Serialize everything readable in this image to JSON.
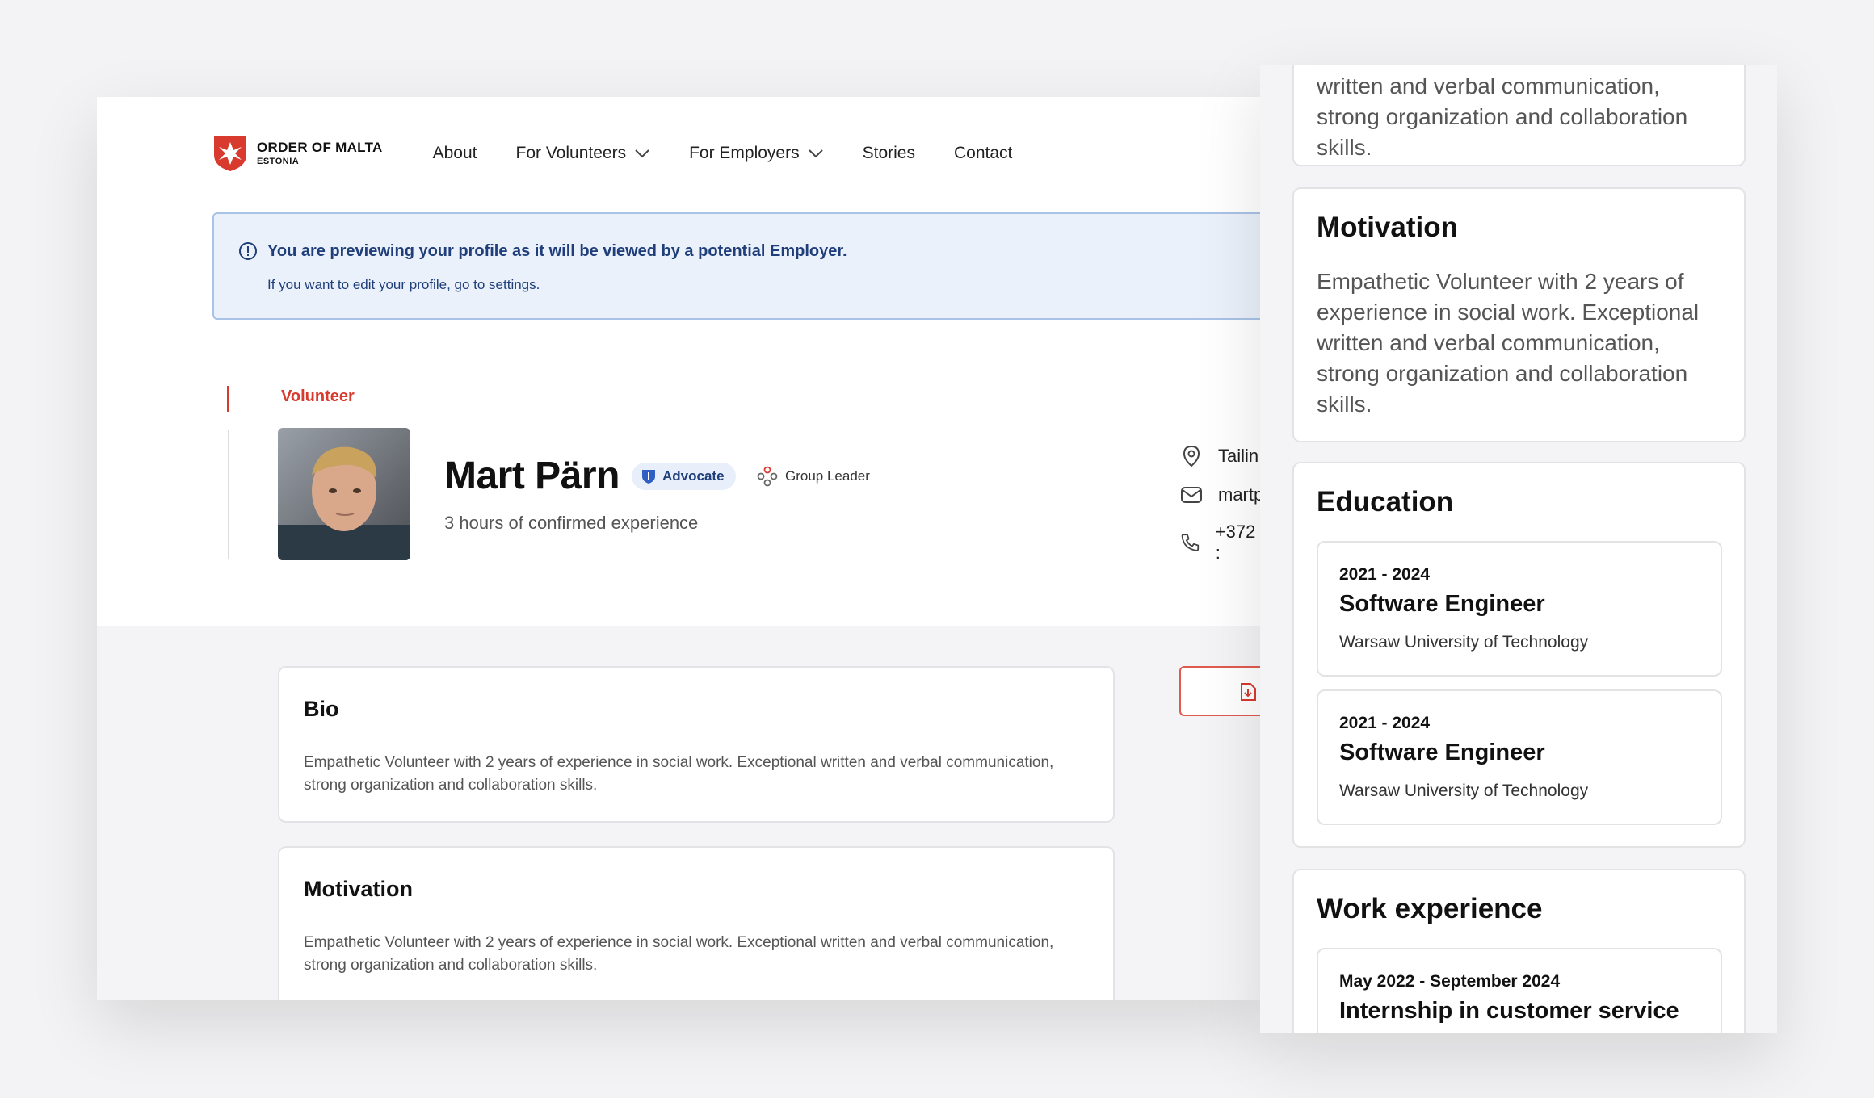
{
  "brand": {
    "name": "ORDER OF MALTA",
    "sub": "ESTONIA",
    "color": "#d83a2e"
  },
  "nav": {
    "items": [
      {
        "label": "About",
        "has_dropdown": false
      },
      {
        "label": "For Volunteers",
        "has_dropdown": true
      },
      {
        "label": "For Employers",
        "has_dropdown": true
      },
      {
        "label": "Stories",
        "has_dropdown": false
      },
      {
        "label": "Contact",
        "has_dropdown": false
      }
    ]
  },
  "notice": {
    "title": "You are previewing your profile as it will be viewed by a potential Employer.",
    "subtitle": "If you want to edit your profile, go to settings."
  },
  "profile": {
    "role": "Volunteer",
    "name": "Mart Pärn",
    "badge_primary": "Advocate",
    "badge_secondary": "Group Leader",
    "experience": "3 hours of confirmed experience",
    "location": "Tailin",
    "email": "martp",
    "phone": "+372 :"
  },
  "cards": {
    "bio": {
      "title": "Bio",
      "text": "Empathetic Volunteer with 2 years of experience in social work. Exceptional written and verbal communication, strong organization and collaboration skills."
    },
    "motivation": {
      "title": "Motivation",
      "text": "Empathetic Volunteer with 2 years of experience in social work. Exceptional written and verbal communication, strong organization and collaboration skills."
    }
  },
  "mobile": {
    "top_partial_text": "written and verbal communication, strong organization and collaboration skills.",
    "motivation": {
      "title": "Motivation",
      "text": "Empathetic Volunteer with 2 years of experience in social work. Exceptional written and verbal communication, strong organization and collaboration skills."
    },
    "education": {
      "title": "Education",
      "items": [
        {
          "dates": "2021 - 2024",
          "title": "Software Engineer",
          "school": "Warsaw University of Technology"
        },
        {
          "dates": "2021 - 2024",
          "title": "Software Engineer",
          "school": "Warsaw University of Technology"
        }
      ]
    },
    "work": {
      "title": "Work experience",
      "items": [
        {
          "dates": "May 2022 - September 2024",
          "title": "Internship in customer service"
        }
      ]
    }
  }
}
